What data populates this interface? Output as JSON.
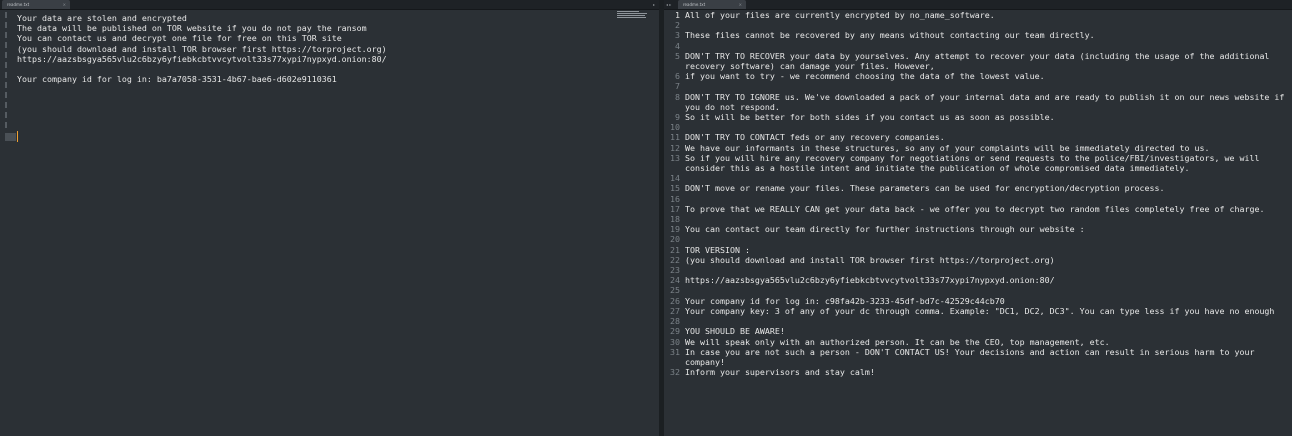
{
  "left": {
    "tab_title": "readme.txt",
    "tab_close": "×",
    "nav": "▸",
    "lines": [
      "Your data are stolen and encrypted",
      "The data will be published on TOR website if you do not pay the ransom",
      "You can contact us and decrypt one file for free on this TOR site",
      "(you should download and install TOR browser first https://torproject.org)",
      "https://aazsbsgya565vlu2c6bzy6yfiebkcbtvvcytvolt33s77xypi7nypxyd.onion:80/",
      "",
      "Your company id for log in: ba7a7058-3531-4b67-bae6-d602e9110361"
    ]
  },
  "right": {
    "tab_title": "readme.txt",
    "tab_close": "×",
    "nav": "◂ ▸",
    "lines": [
      {
        "n": "1",
        "t": "All of your files are currently encrypted by no_name_software."
      },
      {
        "n": "2",
        "t": ""
      },
      {
        "n": "3",
        "t": "These files cannot be recovered by any means without contacting our team directly."
      },
      {
        "n": "4",
        "t": ""
      },
      {
        "n": "5",
        "t": "DON'T TRY TO RECOVER your data by yourselves. Any attempt to recover your data (including the usage of the additional recovery software) can damage your files. However,"
      },
      {
        "n": "6",
        "t": "if you want to try - we recommend choosing the data of the lowest value."
      },
      {
        "n": "7",
        "t": ""
      },
      {
        "n": "8",
        "t": "DON'T TRY TO IGNORE us. We've downloaded a pack of your internal data and are ready to publish it on our news website if you do not respond."
      },
      {
        "n": "9",
        "t": "So it will be better for both sides if you contact us as soon as possible."
      },
      {
        "n": "10",
        "t": ""
      },
      {
        "n": "11",
        "t": "DON'T TRY TO CONTACT feds or any recovery companies."
      },
      {
        "n": "12",
        "t": "We have our informants in these structures, so any of your complaints will be immediately directed to us."
      },
      {
        "n": "13",
        "t": "So if you will hire any recovery company for negotiations or send requests to the police/FBI/investigators, we will consider this as a hostile intent and initiate the publication of whole compromised data immediately."
      },
      {
        "n": "14",
        "t": ""
      },
      {
        "n": "15",
        "t": "DON'T move or rename your files. These parameters can be used for encryption/decryption process."
      },
      {
        "n": "16",
        "t": ""
      },
      {
        "n": "17",
        "t": "To prove that we REALLY CAN get your data back - we offer you to decrypt two random files completely free of charge."
      },
      {
        "n": "18",
        "t": ""
      },
      {
        "n": "19",
        "t": "You can contact our team directly for further instructions through our website :"
      },
      {
        "n": "20",
        "t": ""
      },
      {
        "n": "21",
        "t": "TOR VERSION :"
      },
      {
        "n": "22",
        "t": "(you should download and install TOR browser first https://torproject.org)"
      },
      {
        "n": "23",
        "t": ""
      },
      {
        "n": "24",
        "t": "https://aazsbsgya565vlu2c6bzy6yfiebkcbtvvcytvolt33s77xypi7nypxyd.onion:80/"
      },
      {
        "n": "25",
        "t": ""
      },
      {
        "n": "26",
        "t": "Your company id for log in: c98fa42b-3233-45df-bd7c-42529c44cb70"
      },
      {
        "n": "27",
        "t": "Your company key: 3 of any of your dc through comma. Example: \"DC1, DC2, DC3\". You can type less if you have no enough"
      },
      {
        "n": "28",
        "t": ""
      },
      {
        "n": "29",
        "t": "YOU SHOULD BE AWARE!"
      },
      {
        "n": "30",
        "t": "We will speak only with an authorized person. It can be the CEO, top management, etc."
      },
      {
        "n": "31",
        "t": "In case you are not such a person - DON'T CONTACT US! Your decisions and action can result in serious harm to your company!"
      },
      {
        "n": "32",
        "t": "Inform your supervisors and stay calm!"
      }
    ]
  }
}
